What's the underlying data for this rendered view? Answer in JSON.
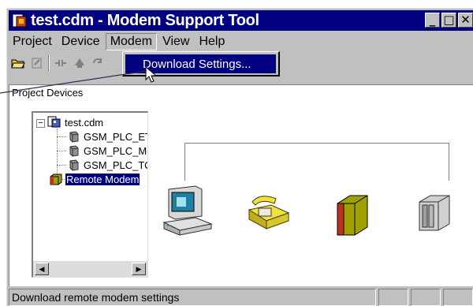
{
  "window": {
    "title": "test.cdm - Modem Support Tool",
    "controls": {
      "minimize": "_",
      "maximize": "□",
      "close": "✕"
    }
  },
  "menu": [
    {
      "label": "Project",
      "active": false
    },
    {
      "label": "Device",
      "active": false
    },
    {
      "label": "Modem",
      "active": true
    },
    {
      "label": "View",
      "active": false
    },
    {
      "label": "Help",
      "active": false
    }
  ],
  "dropdown": {
    "item": "Download Settings..."
  },
  "panel": {
    "label": "Project Devices",
    "tree": {
      "root": "test.cdm",
      "children": [
        "GSM_PLC_ETH",
        "GSM_PLC_Moc",
        "GSM_PLC_TOC"
      ],
      "remote": "Remote Modem"
    }
  },
  "statusbar": {
    "text": "Download remote modem settings"
  },
  "colors": {
    "titlebar": "#000080",
    "selection": "#000080",
    "face": "#c0c0c0"
  }
}
